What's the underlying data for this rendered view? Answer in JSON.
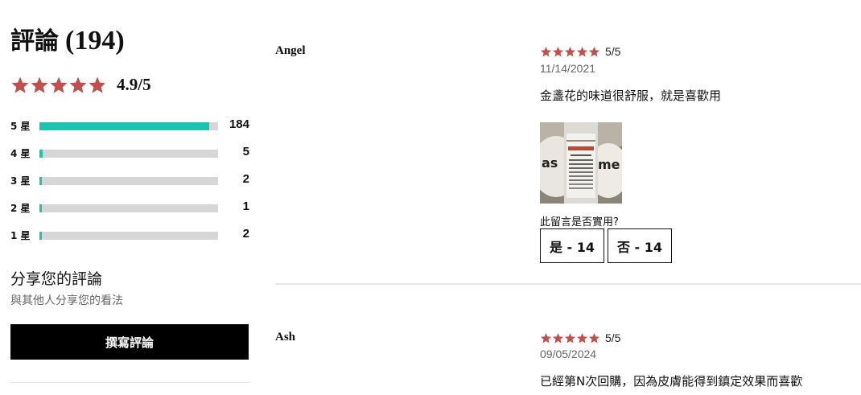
{
  "summary": {
    "title_label": "評論",
    "title_count": "(194)",
    "average_stars": 4.9,
    "average_label": "4.9/5",
    "star_color": "#c0504d",
    "distribution": [
      {
        "label": "5 星",
        "count": "184",
        "fraction": 0.95
      },
      {
        "label": "4 星",
        "count": "5",
        "fraction": 0.02
      },
      {
        "label": "3 星",
        "count": "2",
        "fraction": 0.01
      },
      {
        "label": "2 星",
        "count": "1",
        "fraction": 0.0
      },
      {
        "label": "1 星",
        "count": "2",
        "fraction": 0.01
      }
    ],
    "bar_color": "#1cc3b2",
    "share_title": "分享您的評論",
    "share_subtitle": "與其他人分享您的看法",
    "write_button": "撰寫評論"
  },
  "reviews": [
    {
      "reviewer": "Angel",
      "stars": 5,
      "rating_label": "5/5",
      "date": "11/14/2021",
      "text": "金盞花的味道很舒服，就是喜歡用",
      "photo_icon": "product-bottle-photo",
      "helpful_question": "此留言是否實用?",
      "yes_label": "是 - 14",
      "no_label": "否 - 14"
    },
    {
      "reviewer": "Ash",
      "stars": 5,
      "rating_label": "5/5",
      "date": "09/05/2024",
      "text": "已經第N次回購，因為皮膚能得到鎮定效果而喜歡"
    }
  ]
}
